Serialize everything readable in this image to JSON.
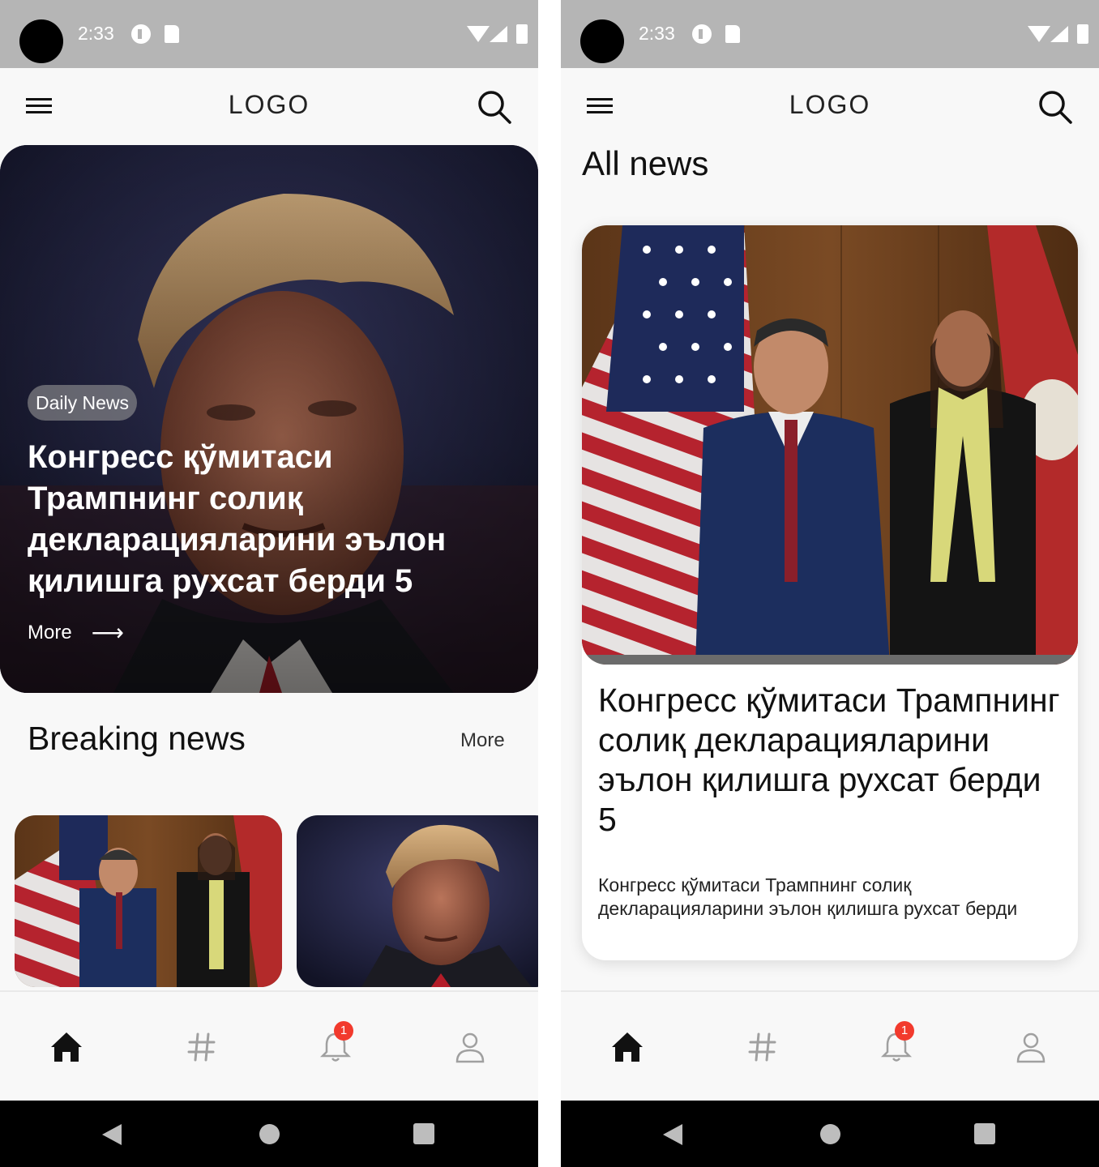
{
  "status_bar": {
    "time": "2:33"
  },
  "app_bar": {
    "logo": "LOGO"
  },
  "home": {
    "hero": {
      "tag": "Daily News",
      "title": "Конгресс қўмитаси Трампнинг солиқ декларацияларини эълон қилишга рухсат берди 5",
      "more": "More",
      "arrow": "⟶"
    },
    "breaking": {
      "title": "Breaking news",
      "more": "More"
    }
  },
  "all_news": {
    "title": "All news",
    "card": {
      "title": "Конгресс қўмитаси Трампнинг солиқ декларацияларини эълон қилишга рухсат берди 5",
      "description": "Конгресс қўмитаси Трампнинг солиқ декларацияларини эълон қилишга рухсат берди"
    }
  },
  "bottom_nav": {
    "items": [
      {
        "icon": "home-icon",
        "active": true
      },
      {
        "icon": "hashtag-icon",
        "active": false
      },
      {
        "icon": "bell-icon",
        "active": false,
        "badge": "1"
      },
      {
        "icon": "profile-icon",
        "active": false
      }
    ]
  },
  "colors": {
    "badge": "#f23a2d",
    "status_bar": "#b5b5b5",
    "background": "#f8f8f8"
  }
}
